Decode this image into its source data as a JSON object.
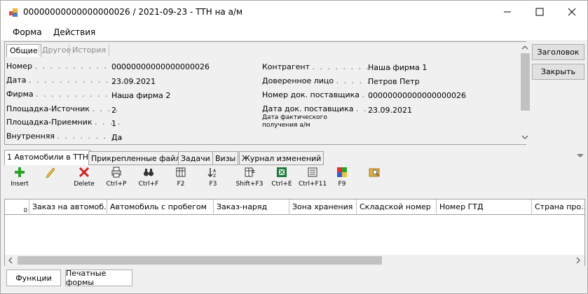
{
  "window": {
    "title": "00000000000000000026 / 2021-09-23 - ТТН на а/м"
  },
  "menu": {
    "items": [
      "Форма",
      "Действия"
    ]
  },
  "top_tabs": [
    "Общие",
    "Другое",
    "История"
  ],
  "fields_left": [
    {
      "label": "Номер",
      "value": "00000000000000000026"
    },
    {
      "label": "Дата",
      "value": "23.09.2021"
    },
    {
      "label": "Фирма",
      "value": "Наша фирма 2"
    },
    {
      "label": "Площадка-Источник",
      "value": "2"
    },
    {
      "label": "Площадка-Приемник",
      "value": "1"
    },
    {
      "label": "Внутренняя",
      "value": "Да"
    }
  ],
  "fields_right": [
    {
      "label": "Контрагент",
      "value": "Наша фирма 1"
    },
    {
      "label": "Доверенное лицо",
      "value": "Петров Петр"
    },
    {
      "label": "Номер док. поставщика",
      "value": "00000000000000000026"
    },
    {
      "label": "Дата док. поставщика",
      "value": "23.09.2021"
    },
    {
      "label": "Дата фактического получения а/м",
      "value": ""
    }
  ],
  "side_buttons": {
    "header": "Заголовок",
    "close": "Закрыть"
  },
  "bottom_tabs": [
    "1 Автомобили в ТТН",
    "Прикрепленные файлы",
    "Задачи",
    "Визы",
    "Журнал изменений"
  ],
  "toolbar": [
    {
      "label": "Insert",
      "icon": "plus-icon"
    },
    {
      "label": "",
      "icon": "pencil-icon"
    },
    {
      "label": "Delete",
      "icon": "delete-icon"
    },
    {
      "label": "Ctrl+P",
      "icon": "print-icon"
    },
    {
      "label": "Ctrl+F",
      "icon": "binoculars-icon"
    },
    {
      "label": "F2",
      "icon": "columns-icon"
    },
    {
      "label": "F3",
      "icon": "sort-icon"
    },
    {
      "label": "Shift+F3",
      "icon": "filter-icon"
    },
    {
      "label": "Ctrl+E",
      "icon": "excel-icon"
    },
    {
      "label": "Ctrl+F11",
      "icon": "list-icon"
    },
    {
      "label": "F9",
      "icon": "colors-icon"
    },
    {
      "label": "",
      "icon": "search-folder-icon"
    }
  ],
  "grid": {
    "row_count": "0",
    "columns": [
      "Заказ на автомоб...",
      "Автомобиль с пробегом",
      "Заказ-наряд",
      "Зона хранения",
      "Складской номер",
      "Номер ГТД",
      "Страна про..."
    ]
  },
  "bottom_buttons": {
    "functions": "Функции",
    "print_forms": "Печатные формы"
  }
}
